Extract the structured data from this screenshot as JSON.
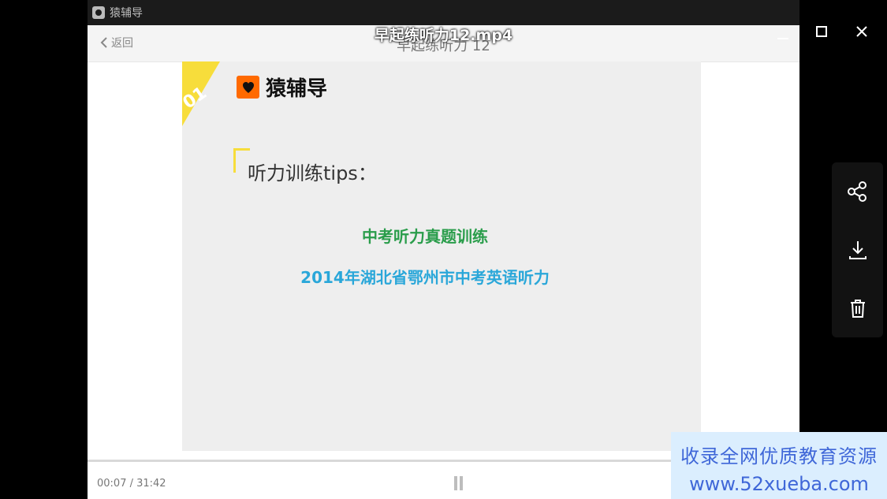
{
  "viewer": {
    "title": "早起练听力12.mp4"
  },
  "app": {
    "name": "猿辅导",
    "nav": {
      "back_label": "返回",
      "title": "早起练听力 12"
    }
  },
  "slide": {
    "corner_number": "01",
    "brand_name": "猿辅导",
    "tips_title": "听力训练tips：",
    "line1": "中考听力真题训练",
    "line2": "2014年湖北省鄂州市中考英语听力"
  },
  "player": {
    "time": "00:07 / 31:42"
  },
  "watermark": {
    "line1": "收录全网优质教育资源",
    "line2": "www.52xueba.com"
  },
  "colors": {
    "accent_yellow": "#f7dd3b",
    "brand_orange": "#ff6a00",
    "green_text": "#2a9d4b",
    "blue_text": "#2aa7d9",
    "watermark_bg": "#dbeefe",
    "watermark_text": "#3f67d8"
  },
  "icons": {
    "minimize": "minimize-icon",
    "maximize": "maximize-icon",
    "close": "close-icon",
    "share": "share-icon",
    "download": "download-icon",
    "delete": "trash-icon",
    "pause": "pause-icon",
    "back": "chevron-left-icon"
  }
}
